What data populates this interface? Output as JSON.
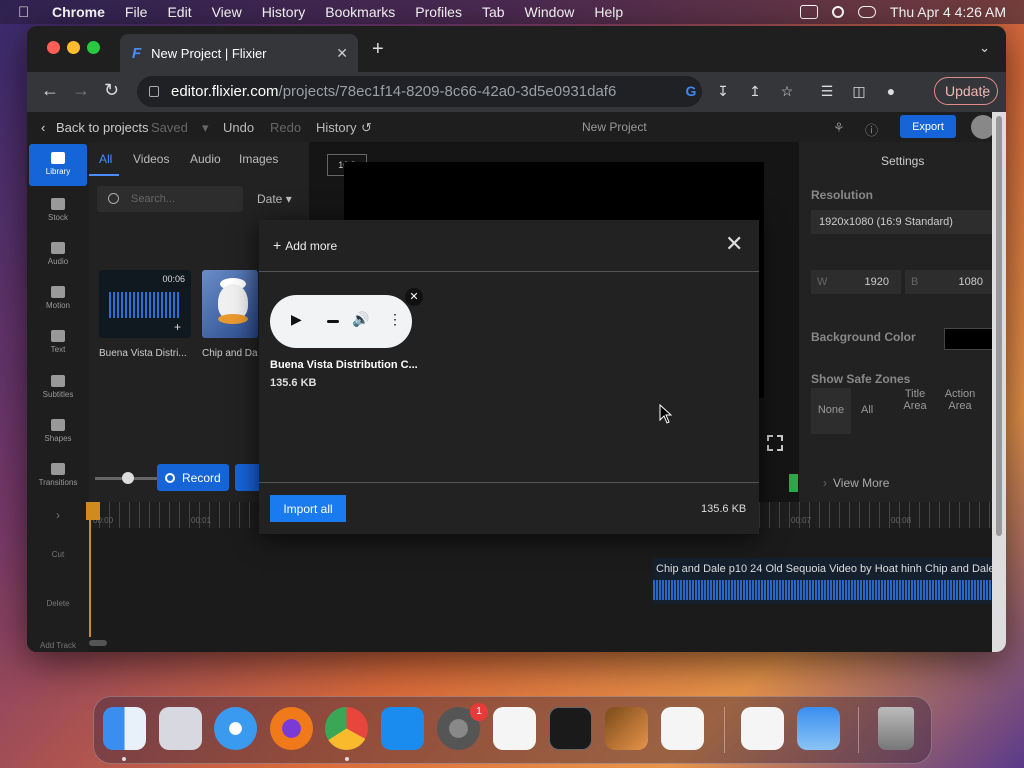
{
  "menubar": {
    "app": "Chrome",
    "items": [
      "File",
      "Edit",
      "View",
      "History",
      "Bookmarks",
      "Profiles",
      "Tab",
      "Window",
      "Help"
    ],
    "clock": "Thu Apr 4  4:26 AM"
  },
  "browser": {
    "tab_title": "New Project | Flixier",
    "favicon": "F",
    "url_host": "editor.flixier.com",
    "url_path": "/projects/78ec1f14-8209-8c66-42a0-3d5e0931daf6",
    "update_label": "Update"
  },
  "app": {
    "back_label": "Back to projects",
    "saved_label": "Saved",
    "undo_label": "Undo",
    "redo_label": "Redo",
    "history_label": "History",
    "project_title": "New Project",
    "export_label": "Export",
    "nav": [
      "Library",
      "Stock",
      "Audio",
      "Motion",
      "Text",
      "Subtitles",
      "Shapes",
      "Transitions"
    ],
    "library_tabs": [
      "All",
      "Videos",
      "Audio",
      "Images"
    ],
    "search_placeholder": "Search...",
    "sort_label": "Date",
    "media": [
      {
        "label": "Buena Vista Distri...",
        "duration": "00:06"
      },
      {
        "label": "Chip and Da"
      }
    ],
    "record_label": "Record",
    "ratio_label": "16:9",
    "settings": {
      "title": "Settings",
      "resolution_label": "Resolution",
      "resolution_value": "1920x1080 (16:9 Standard)",
      "width_prefix": "W",
      "width_value": "1920",
      "height_prefix": "B",
      "height_value": "1080",
      "bg_color_label": "Background Color",
      "safe_zones_label": "Show Safe Zones",
      "safe_options": [
        "None",
        "All",
        "Title Area",
        "Action Area"
      ],
      "view_more": "View More"
    },
    "timeline": {
      "tools": [
        "Cut",
        "Delete",
        "Add Track"
      ],
      "ticks": [
        "00:00",
        "00:01",
        "00:07",
        "00:08"
      ],
      "clip_label": "Chip and Dale p10 24 Old Sequoia Video by Hoat hinh Chip and Dale"
    }
  },
  "modal": {
    "add_more_label": "Add more",
    "file_name": "Buena Vista Distribution C...",
    "file_size": "135.6 KB",
    "import_label": "Import all",
    "total_size": "135.6 KB"
  },
  "dock": {
    "apps": [
      "Finder",
      "Launchpad",
      "Safari",
      "Firefox",
      "Chrome",
      "App Store",
      "System Preferences",
      "TextEdit",
      "Terminal",
      "GarageBand",
      "VS Code",
      "Visual Studio",
      "Weather",
      "Trash"
    ],
    "badge": "1"
  },
  "colors": {
    "accent": "#1565d8",
    "import_button": "#1a7bf0",
    "playhead": "#d18a1e",
    "wave": "#2a6fd6"
  }
}
